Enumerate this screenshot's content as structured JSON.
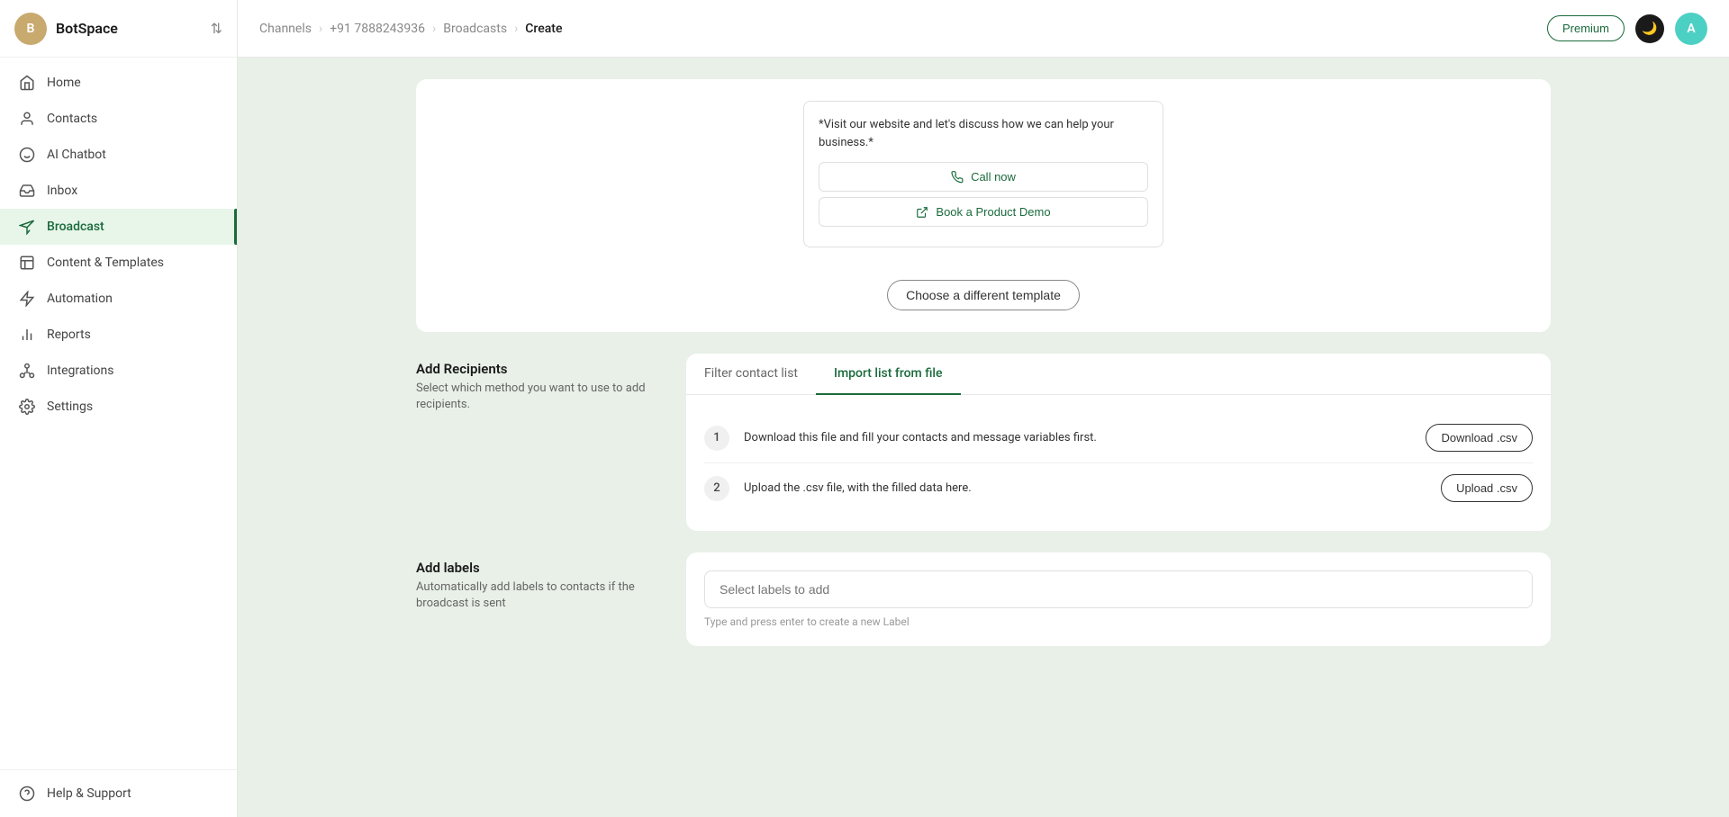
{
  "brand": {
    "initial": "B",
    "name": "BotSpace",
    "toggle_char": "⇅"
  },
  "nav": {
    "items": [
      {
        "id": "home",
        "label": "Home",
        "icon": "home"
      },
      {
        "id": "contacts",
        "label": "Contacts",
        "icon": "person"
      },
      {
        "id": "ai-chatbot",
        "label": "AI Chatbot",
        "icon": "bot"
      },
      {
        "id": "inbox",
        "label": "Inbox",
        "icon": "inbox"
      },
      {
        "id": "broadcast",
        "label": "Broadcast",
        "icon": "broadcast",
        "active": true
      },
      {
        "id": "content-templates",
        "label": "Content & Templates",
        "icon": "content"
      },
      {
        "id": "automation",
        "label": "Automation",
        "icon": "automation"
      },
      {
        "id": "reports",
        "label": "Reports",
        "icon": "reports"
      },
      {
        "id": "integrations",
        "label": "Integrations",
        "icon": "integrations"
      },
      {
        "id": "settings",
        "label": "Settings",
        "icon": "settings"
      }
    ],
    "footer": {
      "label": "Help & Support",
      "icon": "help"
    }
  },
  "topbar": {
    "breadcrumb": {
      "channels": "Channels",
      "sep1": ">",
      "phone": "+91 7888243936",
      "sep2": ">",
      "broadcasts": "Broadcasts",
      "sep3": ">",
      "current": "Create"
    },
    "premium_label": "Premium",
    "user_initial": "A"
  },
  "template_section": {
    "preview": {
      "text": "*Visit our website and let's discuss how we can help your business.*",
      "buttons": [
        {
          "icon": "phone",
          "label": "Call now"
        },
        {
          "icon": "link",
          "label": "Book a Product Demo"
        }
      ]
    },
    "choose_template_label": "Choose a different template"
  },
  "recipients_section": {
    "heading": "Add Recipients",
    "description": "Select which method you want to use to add recipients.",
    "tabs": [
      {
        "id": "filter",
        "label": "Filter contact list",
        "active": false
      },
      {
        "id": "import",
        "label": "Import list from file",
        "active": true
      }
    ],
    "steps": [
      {
        "num": "1",
        "text": "Download this file and fill your contacts and message variables first.",
        "button_label": "Download .csv"
      },
      {
        "num": "2",
        "text": "Upload the .csv file, with the filled data here.",
        "button_label": "Upload .csv"
      }
    ]
  },
  "labels_section": {
    "heading": "Add labels",
    "description": "Automatically add labels to contacts if the broadcast is sent",
    "input_placeholder": "Select labels to add",
    "hint": "Type and press enter to create a new Label"
  }
}
